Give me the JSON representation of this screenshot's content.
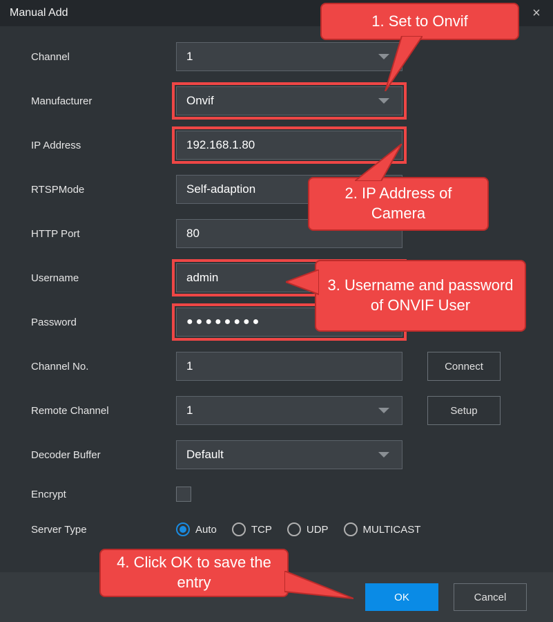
{
  "title": "Manual Add",
  "labels": {
    "channel": "Channel",
    "manufacturer": "Manufacturer",
    "ip": "IP Address",
    "rtsp": "RTSPMode",
    "http": "HTTP Port",
    "username": "Username",
    "password": "Password",
    "channelno": "Channel No.",
    "remote": "Remote Channel",
    "decoder": "Decoder Buffer",
    "encrypt": "Encrypt",
    "server": "Server Type"
  },
  "values": {
    "channel": "1",
    "manufacturer": "Onvif",
    "ip": "192.168.1.80",
    "rtsp": "Self-adaption",
    "http": "80",
    "username": "admin",
    "password": "●●●●●●●●",
    "channelno": "1",
    "remote": "1",
    "decoder": "Default"
  },
  "radios": {
    "auto": "Auto",
    "tcp": "TCP",
    "udp": "UDP",
    "multicast": "MULTICAST"
  },
  "buttons": {
    "connect": "Connect",
    "setup": "Setup",
    "ok": "OK",
    "cancel": "Cancel"
  },
  "callouts": {
    "c1": "1. Set to Onvif",
    "c2": "2. IP Address of Camera",
    "c3": "3. Username and password of ONVIF User",
    "c4": "4. Click OK to save the entry"
  }
}
